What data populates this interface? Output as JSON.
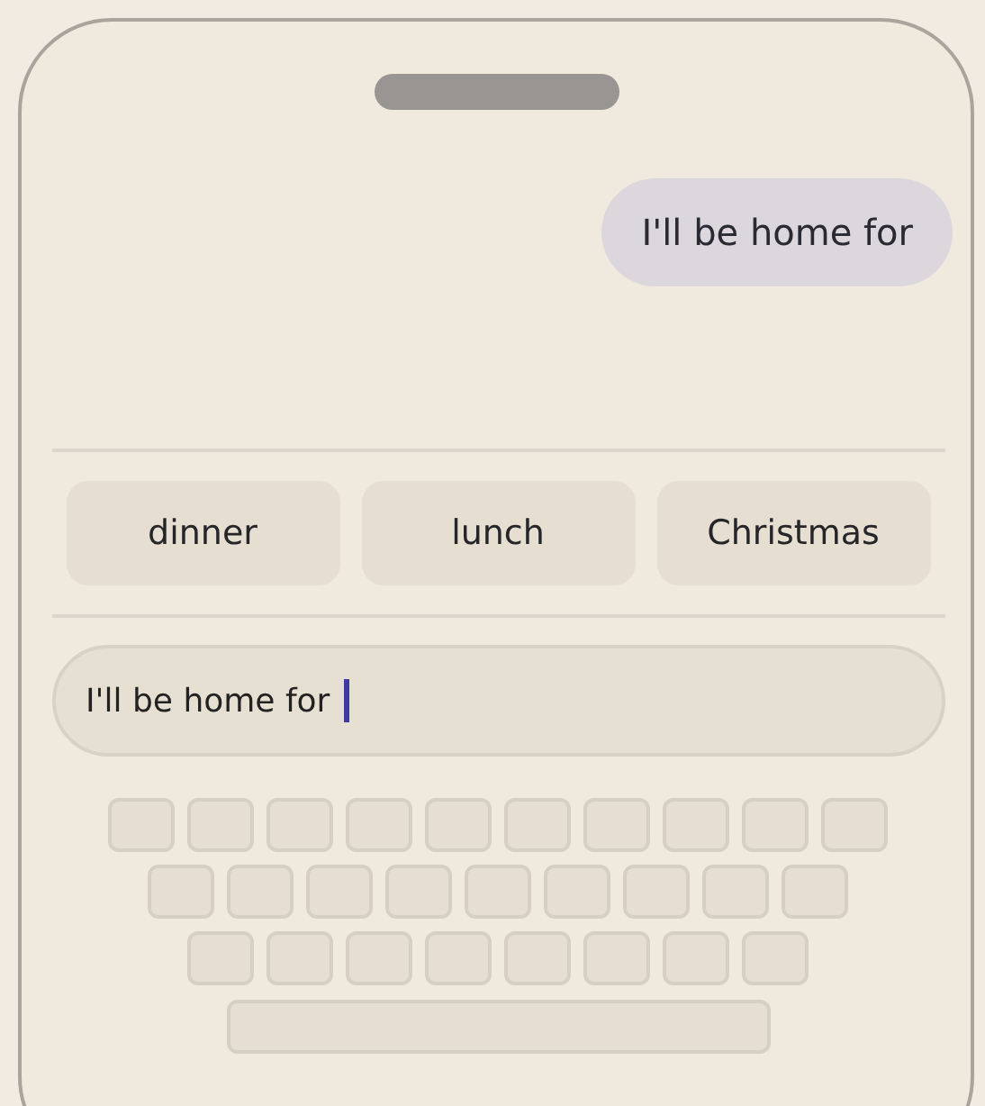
{
  "message": {
    "text": "I'll be home for"
  },
  "suggestions": [
    {
      "label": "dinner"
    },
    {
      "label": "lunch"
    },
    {
      "label": "Christmas"
    }
  ],
  "input": {
    "value": "I'll be home for"
  }
}
